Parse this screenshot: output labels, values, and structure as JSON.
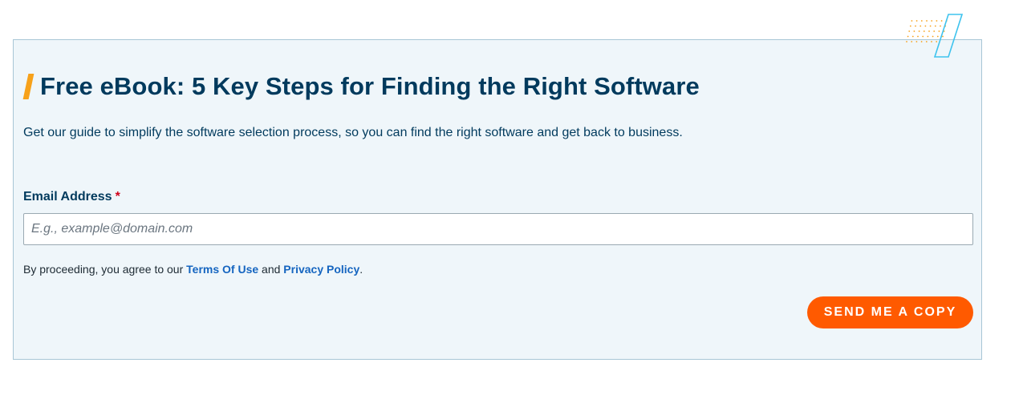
{
  "ebook": {
    "title": "Free eBook: 5 Key Steps for Finding the Right Software",
    "subtitle": "Get our guide to simplify the software selection process, so you can find the right software and get back to business."
  },
  "form": {
    "email_label": "Email Address",
    "required_mark": "*",
    "email_placeholder": "E.g., example@domain.com",
    "email_value": "",
    "consent_prefix": "By proceeding, you agree to our",
    "terms_link": "Terms Of Use",
    "consent_and": "and",
    "privacy_link": "Privacy Policy",
    "consent_suffix": ".",
    "submit_label": "SEND ME A COPY"
  },
  "colors": {
    "accent_orange": "#f7a11a",
    "button_orange": "#ff5a00",
    "heading_navy": "#003a5d",
    "link_blue": "#1565c0",
    "card_background": "#eff6fa",
    "decor_cyan": "#3ec3ee"
  },
  "icons": {
    "decor": "parallelogram-dots-decoration"
  }
}
